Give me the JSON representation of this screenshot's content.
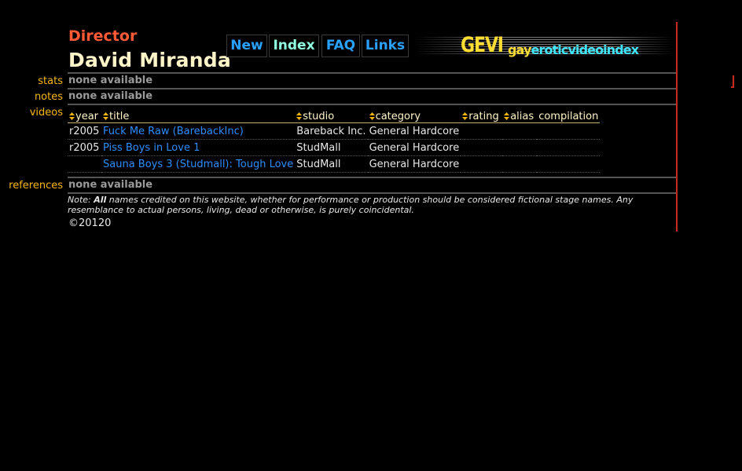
{
  "header": {
    "role": "Director",
    "name": "David Miranda"
  },
  "nav": {
    "new": "New",
    "index": "Index",
    "faq": "FAQ",
    "links": "Links"
  },
  "logo": {
    "main": "GEVI",
    "sub_part1": "gay",
    "sub_part2": "erotic",
    "sub_part3": "video",
    "sub_part4": "index"
  },
  "sections": {
    "stats_label": "stats",
    "stats_value": "none available",
    "notes_label": "notes",
    "notes_value": "none available",
    "videos_label": "videos",
    "references_label": "references",
    "references_value": "none available"
  },
  "videos": {
    "columns": [
      "year",
      "title",
      "studio",
      "category",
      "rating",
      "alias",
      "compilation"
    ],
    "rows": [
      {
        "year": "r2005",
        "title": "Fuck Me Raw (BarebackInc)",
        "studio": "Bareback Inc.",
        "category": "General Hardcore",
        "rating": "",
        "alias": "",
        "compilation": ""
      },
      {
        "year": "r2005",
        "title": "Piss Boys in Love 1",
        "studio": "StudMall",
        "category": "General Hardcore",
        "rating": "",
        "alias": "",
        "compilation": ""
      },
      {
        "year": "",
        "title": "Sauna Boys 3 (Studmall): Tough Love",
        "studio": "StudMall",
        "category": "General Hardcore",
        "rating": "",
        "alias": "",
        "compilation": ""
      }
    ]
  },
  "footer": {
    "note_prefix": "Note: ",
    "note_bold": "All",
    "note_text": " names credited on this website, whether for performance or production should be considered fictional stage names. Any resemblance to actual persons, living, dead or otherwise, is purely coincidental.",
    "copyright": "©20120"
  },
  "colors": {
    "background": "#000000",
    "role": "#ff5a36",
    "name": "#fff5c8",
    "label": "#f5b70f",
    "link": "#2f8dff",
    "nav": "#2aa0ff",
    "nav_active": "#8fffe0",
    "logo_yellow": "#ffdd33",
    "logo_cyan": "#3fe6ff",
    "accent_line": "#c8281e"
  }
}
